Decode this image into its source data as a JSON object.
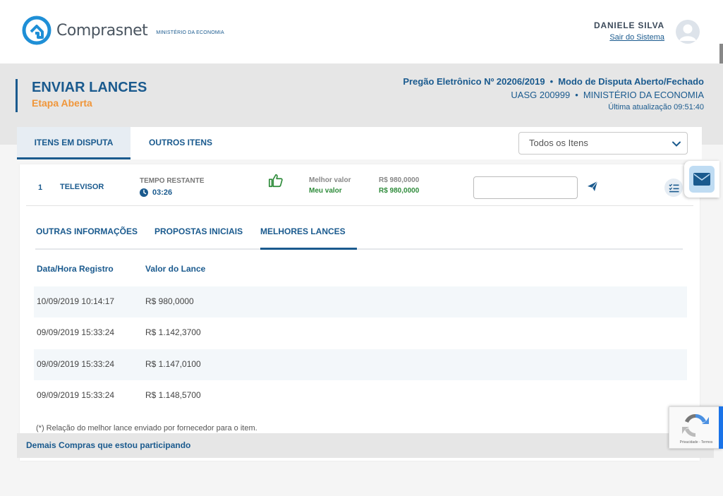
{
  "brand": {
    "name": "Comprasnet",
    "subtitle": "MINISTÉRIO DA ECONOMIA"
  },
  "user": {
    "name": "DANIELE SILVA",
    "logout_label": "Sair do Sistema"
  },
  "page": {
    "title": "ENVIAR LANCES",
    "subtitle": "Etapa Aberta"
  },
  "pregao": {
    "number": "Pregão Eletrônico Nº 20206/2019",
    "mode": "Modo de Disputa Aberto/Fechado",
    "uasg": "UASG 200999",
    "ministry": "MINISTÉRIO DA ECONOMIA",
    "updated": "Última atualização 09:51:40",
    "separator": "•"
  },
  "tabs": [
    {
      "label": "ITENS EM DISPUTA"
    },
    {
      "label": "OUTROS ITENS"
    }
  ],
  "filter": {
    "selected": "Todos os Itens"
  },
  "item": {
    "number": "1",
    "name": "TELEVISOR",
    "time_label": "TEMPO RESTANTE",
    "time_value": "03:26",
    "best_label": "Melhor valor",
    "mine_label": "Meu valor",
    "best_value": "R$ 980,0000",
    "mine_value": "R$ 980,0000"
  },
  "sub_tabs": [
    {
      "label": "OUTRAS INFORMAÇÕES"
    },
    {
      "label": "PROPOSTAS INICIAIS"
    },
    {
      "label": "MELHORES LANCES"
    }
  ],
  "table": {
    "headers": [
      "Data/Hora Registro",
      "Valor do Lance"
    ],
    "rows": [
      {
        "date": "10/09/2019 10:14:17",
        "value": "R$ 980,0000"
      },
      {
        "date": "09/09/2019 15:33:24",
        "value": "R$ 1.142,3700"
      },
      {
        "date": "09/09/2019 15:33:24",
        "value": "R$ 1.147,0100"
      },
      {
        "date": "09/09/2019 15:33:24",
        "value": "R$ 1.148,5700"
      }
    ]
  },
  "footnote": "(*) Relação do melhor lance enviado por fornecedor para o item.",
  "bottom": {
    "link": "Demais Compras que estou participando"
  },
  "recaptcha": {
    "label": "Privacidade - Termos"
  },
  "colors": {
    "primary": "#1a5a8e",
    "accent": "#f0963a",
    "success": "#2e8b3a",
    "band": "#e6e6e6"
  },
  "icons": [
    "logo-icon",
    "avatar-icon",
    "chevron-down-icon",
    "clock-icon",
    "thumbs-up-icon",
    "send-icon",
    "checklist-icon",
    "mail-icon",
    "recaptcha-icon"
  ]
}
